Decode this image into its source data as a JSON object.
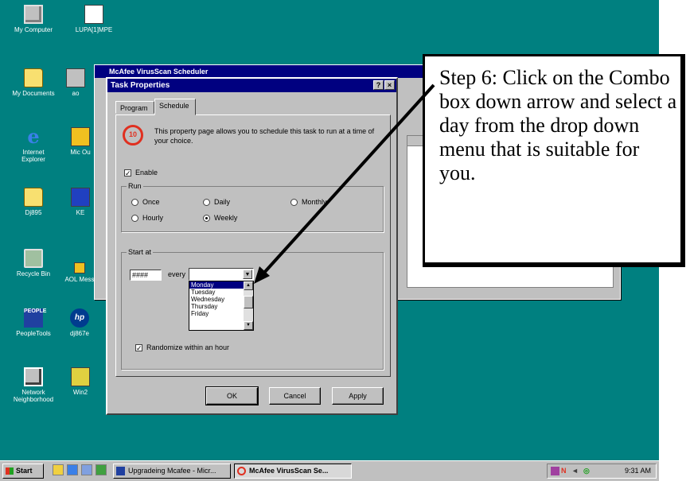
{
  "desktop": {
    "icons": [
      {
        "label": "My Computer"
      },
      {
        "label": "LUPA[1]MPE"
      },
      {
        "label": "My Documents"
      },
      {
        "label": "ao"
      },
      {
        "label": "Internet Explorer"
      },
      {
        "label": "Mic Ou"
      },
      {
        "label": "Dj895"
      },
      {
        "label": "KE"
      },
      {
        "label": "Recycle Bin"
      },
      {
        "label": "AOL Mess"
      },
      {
        "label": "PeopleTools"
      },
      {
        "label": "dj867e"
      },
      {
        "label": "Network Neighborhood"
      },
      {
        "label": "Win2"
      }
    ]
  },
  "background_window": {
    "title": "McAfee VirusScan Scheduler"
  },
  "dialog": {
    "title": "Task Properties",
    "help_btn": "?",
    "close_btn": "×",
    "tabs": [
      {
        "label": "Program"
      },
      {
        "label": "Schedule"
      }
    ],
    "intro": "This property page allows you to schedule this task to run at a time of your choice.",
    "enable_label": "Enable",
    "enable_checked": true,
    "run_group": {
      "title": "Run",
      "options": [
        {
          "label": "Once",
          "selected": false
        },
        {
          "label": "Daily",
          "selected": false
        },
        {
          "label": "Monthly",
          "selected": false
        },
        {
          "label": "Hourly",
          "selected": false
        },
        {
          "label": "Weekly",
          "selected": true
        }
      ]
    },
    "start_group": {
      "title": "Start at",
      "time_value": "####",
      "every_label": "every",
      "day_value": "",
      "days": [
        "Monday",
        "Tuesday",
        "Wednesday",
        "Thursday",
        "Friday"
      ],
      "selected_day": "Monday"
    },
    "randomize_label": "Randomize within an hour",
    "randomize_checked": true,
    "buttons": {
      "ok": "OK",
      "cancel": "Cancel",
      "apply": "Apply"
    }
  },
  "taskbar": {
    "start_label": "Start",
    "tasks": [
      {
        "label": "Upgradeing Mcafee - Micr...",
        "active": false
      },
      {
        "label": "McAfee VirusScan Se...",
        "active": true
      }
    ],
    "clock": "9:31 AM"
  },
  "callout": {
    "text": "Step 6: Click on the Combo box down arrow and select a day from the drop down menu that is suitable for you."
  },
  "colors": {
    "desktop": "#008080",
    "title_bar": "#000080",
    "face": "#c0c0c0"
  }
}
